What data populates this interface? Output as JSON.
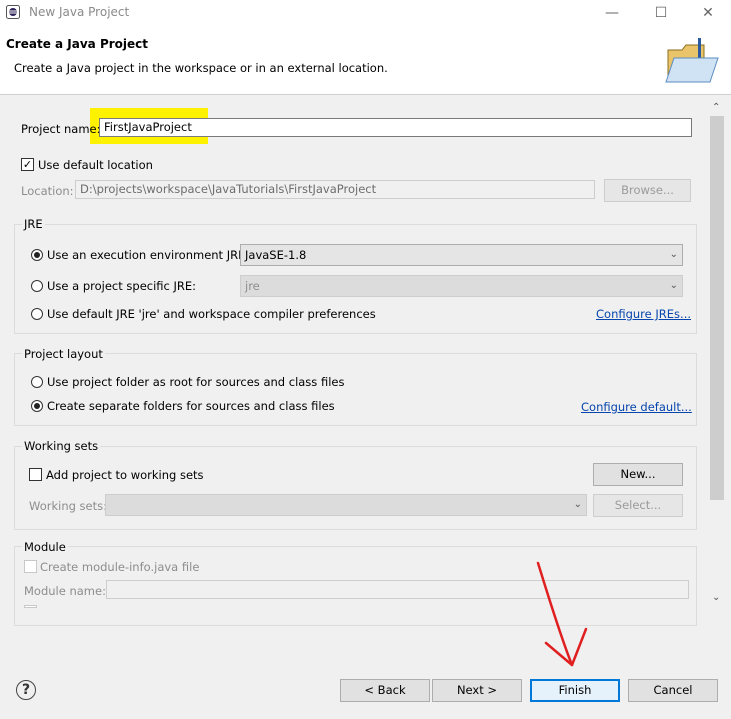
{
  "window": {
    "title": "New Java Project"
  },
  "header": {
    "title": "Create a Java Project",
    "description": "Create a Java project in the workspace or in an external location."
  },
  "project": {
    "name_label": "Project name:",
    "name_value": "FirstJavaProject",
    "use_default_location_label": "Use default location",
    "use_default_location_checked": true,
    "location_label": "Location:",
    "location_value": "D:\\projects\\workspace\\JavaTutorials\\FirstJavaProject",
    "browse_label": "Browse..."
  },
  "jre": {
    "group_title": "JRE",
    "option_exec_env_label": "Use an execution environment JRE:",
    "exec_env_value": "JavaSE-1.8",
    "option_specific_label": "Use a project specific JRE:",
    "specific_value": "jre",
    "option_default_label": "Use default JRE 'jre' and workspace compiler preferences",
    "configure_link": "Configure JREs..."
  },
  "layout": {
    "group_title": "Project layout",
    "option_root_label": "Use project folder as root for sources and class files",
    "option_separate_label": "Create separate folders for sources and class files",
    "configure_link": "Configure default..."
  },
  "working_sets": {
    "group_title": "Working sets",
    "add_label": "Add project to working sets",
    "new_label": "New...",
    "sets_label": "Working sets:",
    "select_label": "Select..."
  },
  "module": {
    "group_title": "Module",
    "create_label": "Create module-info.java file",
    "name_label": "Module name:"
  },
  "footer": {
    "back_label": "< Back",
    "next_label": "Next >",
    "finish_label": "Finish",
    "cancel_label": "Cancel"
  },
  "icons": [
    "eclipse-icon",
    "minimize-icon",
    "maximize-icon",
    "close-icon",
    "folder-icon",
    "help-icon",
    "chevron-down-icon"
  ],
  "colors": {
    "highlight": "#fff200",
    "annotation_arrow": "#e02020",
    "link": "#0645ad"
  }
}
